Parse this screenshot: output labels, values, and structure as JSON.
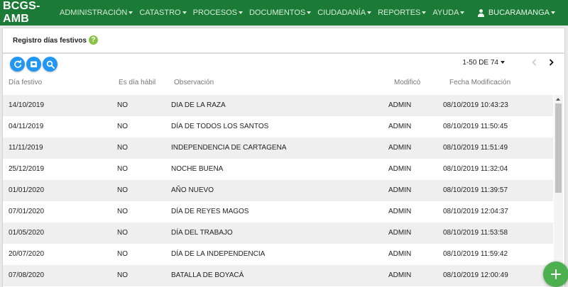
{
  "navbar": {
    "brand": "BCGS-AMB",
    "menu": [
      {
        "label": "ADMINISTRACIÓN"
      },
      {
        "label": "CATASTRO"
      },
      {
        "label": "PROCESOS"
      },
      {
        "label": "DOCUMENTOS"
      },
      {
        "label": "CIUDADANÍA"
      },
      {
        "label": "REPORTES"
      },
      {
        "label": "AYUDA"
      }
    ],
    "user": "BUCARAMANGA"
  },
  "panel": {
    "title": "Registro días festivos",
    "help_glyph": "?"
  },
  "toolbar": {
    "icons": [
      "refresh-icon",
      "export-icon",
      "search-icon"
    ]
  },
  "pager": {
    "range": "1-50 DE 74"
  },
  "table": {
    "columns": [
      "Día festivo",
      "Es día hábil",
      "Observación",
      "Modificó",
      "Fecha Modificación"
    ],
    "rows": [
      [
        "14/10/2019",
        "NO",
        "DIA DE LA RAZA",
        "ADMIN",
        "08/10/2019 10:43:23"
      ],
      [
        "04/11/2019",
        "NO",
        "DÍA DE TODOS LOS SANTOS",
        "ADMIN",
        "08/10/2019 11:50:45"
      ],
      [
        "11/11/2019",
        "NO",
        "INDEPENDENCIA DE CARTAGENA",
        "ADMIN",
        "08/10/2019 11:51:49"
      ],
      [
        "25/12/2019",
        "NO",
        "NOCHE BUENA",
        "ADMIN",
        "08/10/2019 11:32:04"
      ],
      [
        "01/01/2020",
        "NO",
        "AÑO NUEVO",
        "ADMIN",
        "08/10/2019 11:39:57"
      ],
      [
        "07/01/2020",
        "NO",
        "DÍA DE REYES MAGOS",
        "ADMIN",
        "08/10/2019 12:04:37"
      ],
      [
        "01/05/2020",
        "NO",
        "DÍA DEL TRABAJO",
        "ADMIN",
        "08/10/2019 11:53:58"
      ],
      [
        "20/07/2020",
        "NO",
        "DÍA DE LA INDEPENDENCIA",
        "ADMIN",
        "08/10/2019 11:59:42"
      ],
      [
        "07/08/2020",
        "NO",
        "BATALLA DE BOYACÁ",
        "ADMIN",
        "08/10/2019 12:00:49"
      ]
    ]
  },
  "colors": {
    "navbar": "#1b7a36",
    "primary_button": "#2196f3",
    "fab": "#4caf50",
    "help": "#8bc34a"
  },
  "fab": {
    "icon": "plus-icon"
  }
}
